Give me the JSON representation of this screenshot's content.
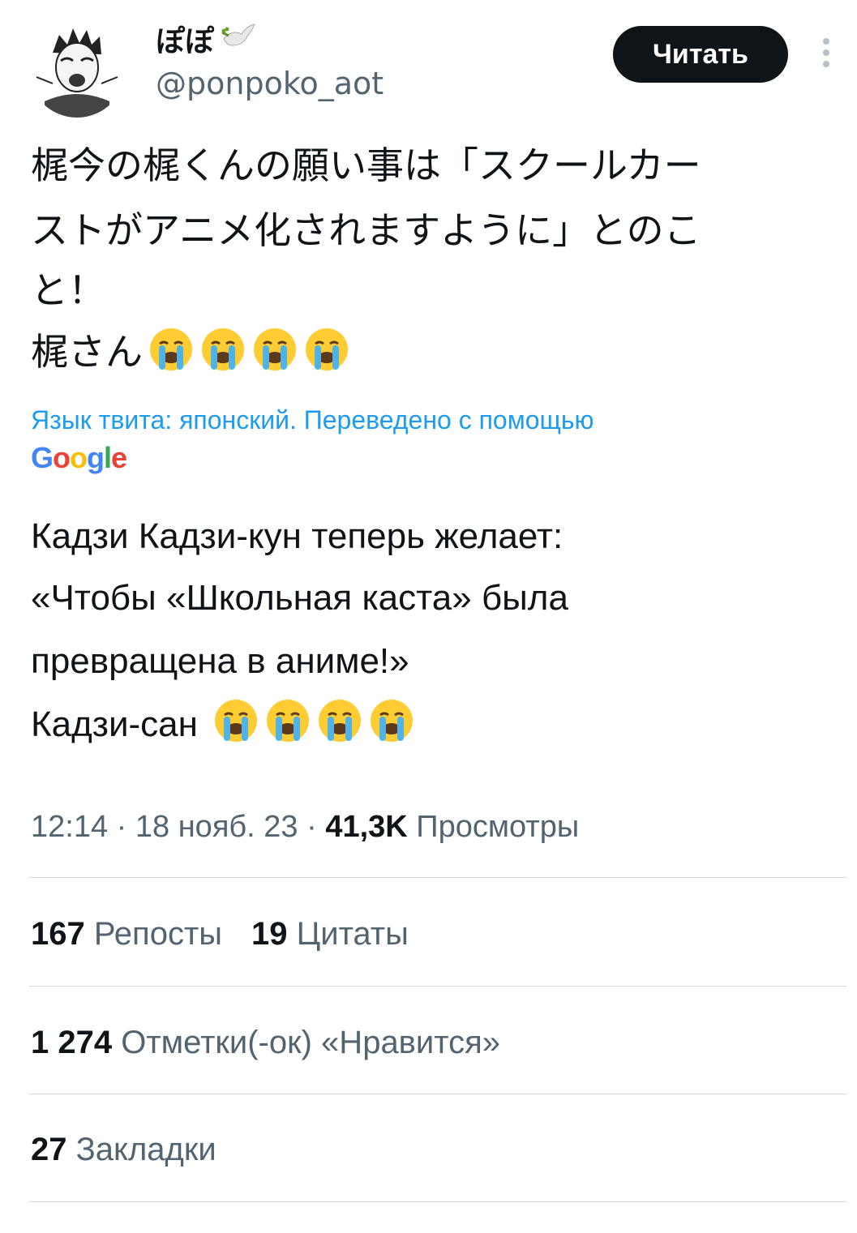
{
  "author": {
    "display_name": "ぽぽ",
    "handle": "@ponpoko_aot"
  },
  "follow_label": "Читать",
  "original_lines": [
    "梶今の梶くんの願い事は「スクールカー",
    "ストがアニメ化されますように」とのこ",
    "と！",
    "梶さん"
  ],
  "translation_note": "Язык твита: японский. Переведено с помощью",
  "translation_provider": "Google",
  "translated_lines": [
    "Кадзи Кадзи-кун теперь желает:",
    "«Чтобы «Школьная каста» была",
    "превращена в аниме!»",
    "Кадзи-сан"
  ],
  "meta": {
    "time": "12:14",
    "sep1": " · ",
    "date": "18 нояб. 23",
    "sep2": " · ",
    "views_count": "41,3K",
    "views_label": " Просмотры"
  },
  "stats": {
    "reposts_count": "167",
    "reposts_label": " Репосты",
    "quotes_count": "19",
    "quotes_label": " Цитаты",
    "likes_count": "1 274",
    "likes_label": " Отметки(-ок) «Нравится»",
    "bookmarks_count": "27",
    "bookmarks_label": " Закладки"
  },
  "icons": {
    "name_badge": "dove-with-olive-branch-icon",
    "emoji": "loudly-crying-face-emoji",
    "more": "more-vertical-icon"
  },
  "colors": {
    "link_blue": "#1d9bf0",
    "secondary_text": "#536471",
    "button_bg": "#0f1419",
    "divider": "#cfd9de"
  }
}
